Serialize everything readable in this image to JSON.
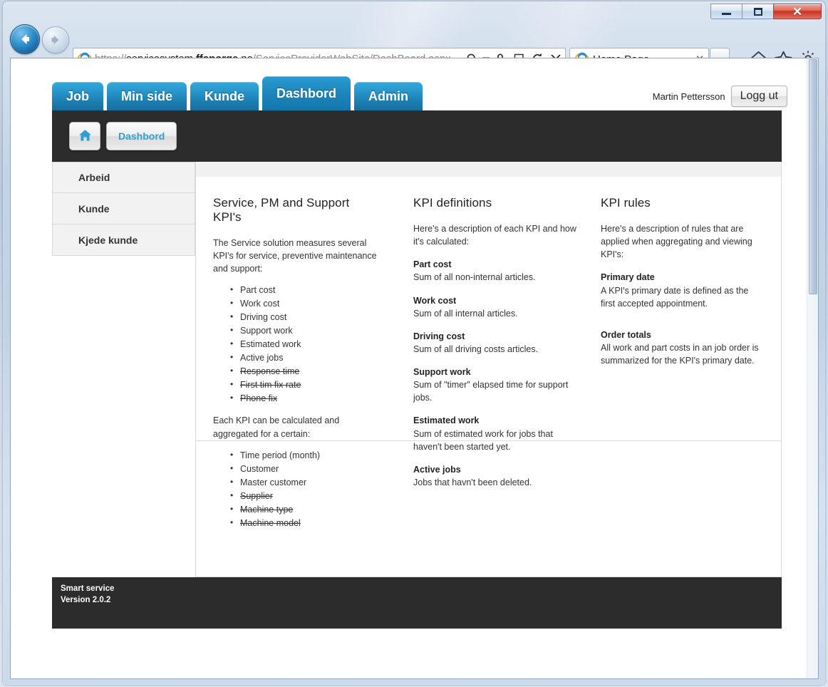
{
  "window": {
    "minimize_label": "minimize",
    "maximize_label": "maximize",
    "close_label": "close"
  },
  "browser": {
    "url_scheme": "https://",
    "url_host": "servicesystem.ffsnorge.no",
    "url_host_bold": "ffsnorge",
    "url_host_pre": "servicesystem.",
    "url_host_post": ".no",
    "url_path": "/ServiceProviderWebSite/DashBoard.aspx",
    "url_full": "https://servicesystem.ffsnorge.no/ServiceProviderWebSite/DashBoard.aspx",
    "tab_title": "Home Page",
    "tab_close_glyph": "✕",
    "icons": {
      "back": "back-arrow-icon",
      "forward": "forward-arrow-icon",
      "favicon": "internet-explorer-icon",
      "search": "search-icon",
      "dropdown": "chevron-down-icon",
      "lock": "lock-icon",
      "compatibility": "compatibility-view-icon",
      "refresh": "refresh-icon",
      "stop": "stop-icon",
      "home": "home-icon",
      "favorites": "star-icon",
      "tools": "gear-icon"
    }
  },
  "topnav": {
    "tabs": [
      {
        "label": "Job",
        "active": false
      },
      {
        "label": "Min side",
        "active": false
      },
      {
        "label": "Kunde",
        "active": false
      },
      {
        "label": "Dashbord",
        "active": true
      },
      {
        "label": "Admin",
        "active": false
      }
    ]
  },
  "user": {
    "name": "Martin Pettersson",
    "logout_label": "Logg ut"
  },
  "breadcrumb": {
    "home_icon": "home-icon",
    "current_label": "Dashbord"
  },
  "sidebar": {
    "items": [
      {
        "label": "Arbeid"
      },
      {
        "label": "Kunde"
      },
      {
        "label": "Kjede kunde"
      }
    ]
  },
  "content": {
    "col1": {
      "heading": "Service, PM and Support KPI's",
      "intro": "The Service solution measures several KPI's for service, preventive maintenance and support:",
      "kpi_list": [
        {
          "label": "Part cost",
          "struck": false
        },
        {
          "label": "Work cost",
          "struck": false
        },
        {
          "label": "Driving cost",
          "struck": false
        },
        {
          "label": "Support work",
          "struck": false
        },
        {
          "label": "Estimated work",
          "struck": false
        },
        {
          "label": "Active jobs",
          "struck": false
        },
        {
          "label": "Response time",
          "struck": true
        },
        {
          "label": "First tim fix rate",
          "struck": true
        },
        {
          "label": "Phone fix",
          "struck": true
        }
      ],
      "intro2": "Each KPI can be calculated and aggregated for a certain:",
      "aggregation_list": [
        {
          "label": "Time period (month)",
          "struck": false
        },
        {
          "label": "Customer",
          "struck": false
        },
        {
          "label": "Master customer",
          "struck": false
        },
        {
          "label": "Supplier",
          "struck": true
        },
        {
          "label": "Machine type",
          "struck": true
        },
        {
          "label": "Machine model",
          "struck": true
        }
      ]
    },
    "col2": {
      "heading": "KPI definitions",
      "intro": "Here's a description of each KPI and how it's calculated:",
      "definitions": [
        {
          "term": "Part cost",
          "desc": "Sum of all non-internal articles."
        },
        {
          "term": "Work cost",
          "desc": "Sum of all internal articles."
        },
        {
          "term": "Driving cost",
          "desc": "Sum of all driving costs articles."
        },
        {
          "term": "Support work",
          "desc": "Sum of \"timer\" elapsed time for support jobs."
        },
        {
          "term": "Estimated work",
          "desc": "Sum of estimated work for jobs that haven't been started yet."
        },
        {
          "term": "Active jobs",
          "desc": "Jobs that havn't been deleted."
        }
      ]
    },
    "col3": {
      "heading": "KPI rules",
      "intro": "Here's a description of rules that are applied when aggregating and viewing KPI's:",
      "rules": [
        {
          "term": "Primary date",
          "desc": "A KPI's primary date is defined as the first accepted appointment."
        },
        {
          "term": "Order totals",
          "desc": "All work and part costs in an job order is summarized for the KPI's primary date."
        }
      ]
    }
  },
  "footer": {
    "product": "Smart service",
    "version": "Version 2.0.2"
  },
  "colors": {
    "tab_blue": "#2492c7",
    "dark_bar": "#2c2c2c",
    "link_blue": "#2e9fd4",
    "close_red": "#cc3222"
  }
}
